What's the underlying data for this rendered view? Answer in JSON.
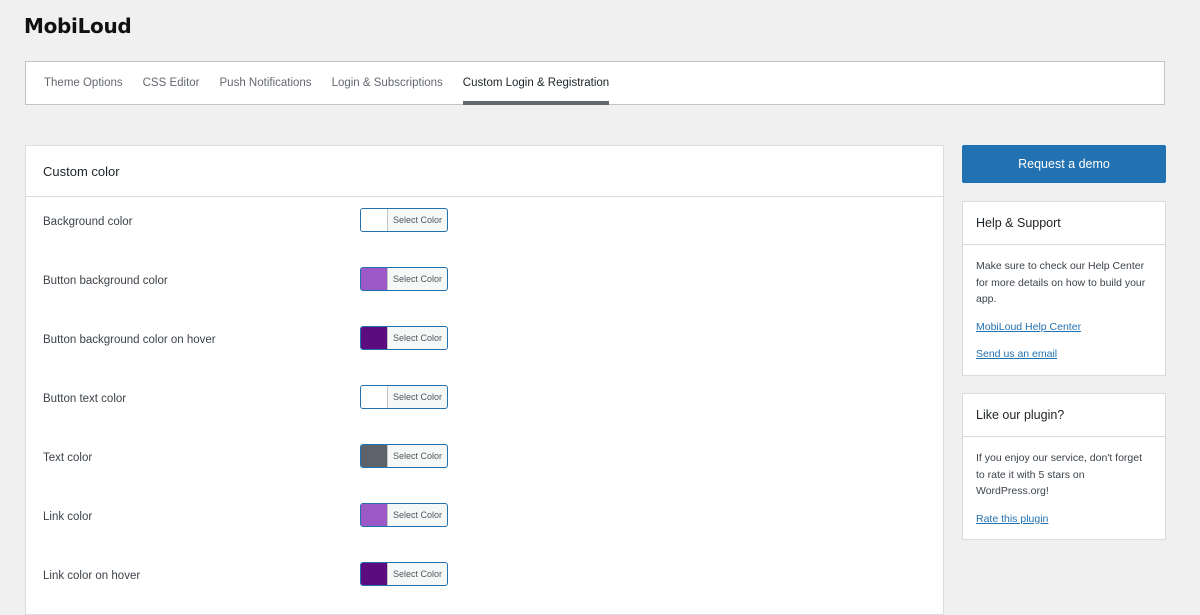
{
  "app": {
    "logo": "MobiLoud"
  },
  "tabs": [
    {
      "label": "Theme Options"
    },
    {
      "label": "CSS Editor"
    },
    {
      "label": "Push Notifications"
    },
    {
      "label": "Login & Subscriptions"
    },
    {
      "label": "Custom Login & Registration",
      "active": true
    }
  ],
  "panel": {
    "title": "Custom color",
    "select_label": "Select Color",
    "rows": [
      {
        "label": "Background color",
        "color": "#ffffff"
      },
      {
        "label": "Button background color",
        "color": "#9b59c6"
      },
      {
        "label": "Button background color on hover",
        "color": "#5b0d7e"
      },
      {
        "label": "Button text color",
        "color": "#ffffff"
      },
      {
        "label": "Text color",
        "color": "#5c636a"
      },
      {
        "label": "Link color",
        "color": "#9b59c6"
      },
      {
        "label": "Link color on hover",
        "color": "#5b0d7e"
      }
    ]
  },
  "sidebar": {
    "demo_button": "Request a demo",
    "help": {
      "title": "Help & Support",
      "text": "Make sure to check our Help Center for more details on how to build your app.",
      "link_help": "MobiLoud Help Center",
      "link_email": "Send us an email"
    },
    "like": {
      "title": "Like our plugin?",
      "text": "If you enjoy our service, don't forget to rate it with 5 stars on WordPress.org!",
      "link_rate": "Rate this plugin"
    }
  },
  "colors": {
    "accent": "#2271b1",
    "background": "#f0f0f1"
  }
}
